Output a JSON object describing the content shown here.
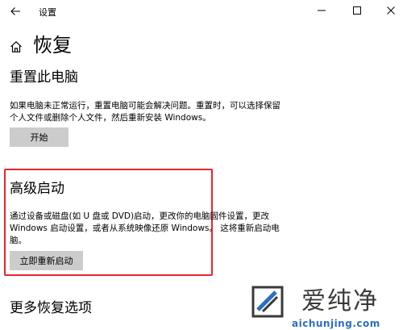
{
  "window": {
    "title": "设置"
  },
  "page": {
    "title": "恢复"
  },
  "reset": {
    "heading": "重置此电脑",
    "line1": "如果电脑未正常运行，重置电脑可能会解决问题。重置时，可以选择保留",
    "line2": "个人文件或删除个人文件，然后重新安装 Windows。",
    "button": "开始"
  },
  "advanced": {
    "heading": "高级启动",
    "line1": "通过设备或磁盘(如 U 盘或 DVD)启动，更改你的电脑固件设置，更改",
    "line2": "Windows 启动设置，或者从系统映像还原 Windows。 这将重新启动电",
    "line3": "脑。",
    "button": "立即重新启动"
  },
  "more": {
    "heading": "更多恢复选项"
  },
  "watermark": {
    "cn": "爱纯净",
    "url": "aichunjing.com"
  },
  "colors": {
    "highlight": "#e8262c",
    "button_bg": "#cccccc",
    "watermark_blue": "#2b6fc2"
  }
}
